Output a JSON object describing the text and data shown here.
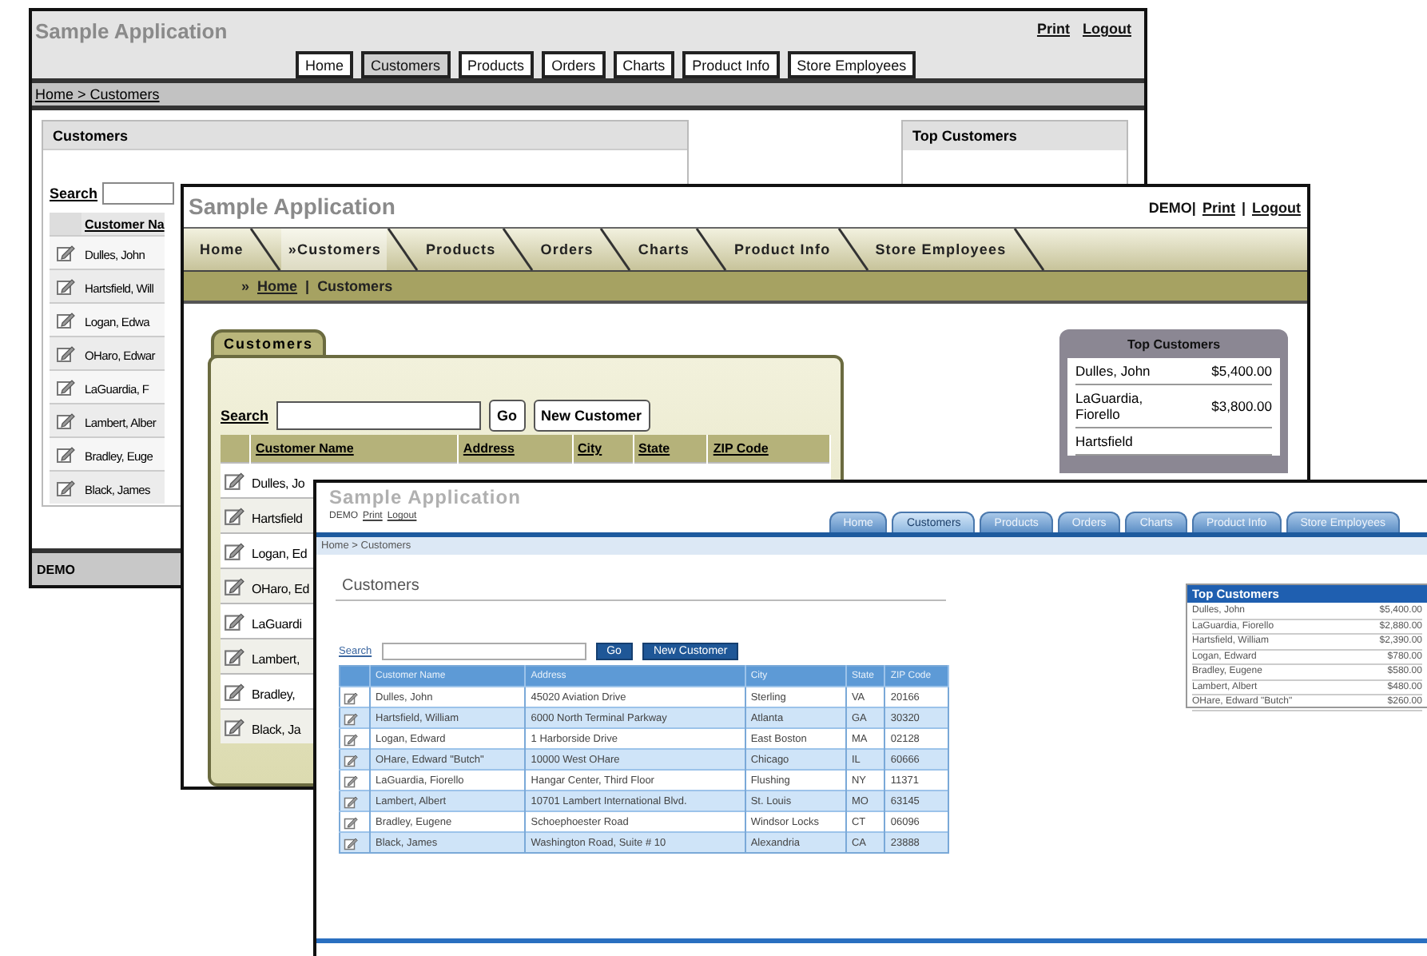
{
  "windows": [
    {
      "kind": "plain",
      "title": "Sample Application",
      "header_items": [
        {
          "text": "Print",
          "link": true
        },
        {
          "text": "Logout",
          "link": true
        }
      ],
      "tabs": [
        {
          "label": "Home",
          "selected": false
        },
        {
          "label": "Customers",
          "selected": true
        },
        {
          "label": "Products",
          "selected": false
        },
        {
          "label": "Orders",
          "selected": false
        },
        {
          "label": "Charts",
          "selected": false
        },
        {
          "label": "Product Info",
          "selected": false
        },
        {
          "label": "Store Employees",
          "selected": false
        }
      ],
      "breadcrumb": [
        {
          "text": "Home > Customers",
          "link": true
        }
      ],
      "region": {
        "title": "Customers",
        "search_label": "Search",
        "columns": [
          "Customer Na"
        ],
        "rows": [
          [
            "Dulles, John"
          ],
          [
            "Hartsfield, Will"
          ],
          [
            "Logan, Edwa"
          ],
          [
            "OHaro, Edwar"
          ],
          [
            "LaGuardia, F"
          ],
          [
            "Lambert, Alber"
          ],
          [
            "Bradley, Euge"
          ],
          [
            "Black, James"
          ]
        ]
      },
      "top_customers": {
        "title": "Top Customers"
      },
      "footer": "DEMO"
    },
    {
      "kind": "olive",
      "title": "Sample Application",
      "header_items": [
        {
          "text": "DEMO|",
          "link": false
        },
        {
          "text": "Print",
          "link": true
        },
        {
          "text": "|"
        },
        {
          "text": "Logout",
          "link": true
        }
      ],
      "tabs": [
        {
          "label": "Home",
          "selected": false
        },
        {
          "label": "»Customers",
          "selected": true
        },
        {
          "label": "Products",
          "selected": false
        },
        {
          "label": "Orders",
          "selected": false
        },
        {
          "label": "Charts",
          "selected": false
        },
        {
          "label": "Product Info",
          "selected": false
        },
        {
          "label": "Store Employees",
          "selected": false
        }
      ],
      "breadcrumb": [
        {
          "text": "»",
          "link": false
        },
        {
          "text": "Home",
          "link": true
        },
        {
          "text": "|"
        },
        {
          "text": "Customers",
          "link": false
        }
      ],
      "region": {
        "title": "Customers",
        "search_label": "Search",
        "buttons": [
          "Go",
          "New Customer"
        ],
        "columns": [
          "Customer Name",
          "Address",
          "City",
          "State",
          "ZIP Code"
        ],
        "rows": [
          [
            "Dulles, Jo"
          ],
          [
            "Hartsfield"
          ],
          [
            "Logan, Ed"
          ],
          [
            "OHaro, Ed"
          ],
          [
            "LaGuardi"
          ],
          [
            "Lambert,"
          ],
          [
            "Bradley,"
          ],
          [
            "Black, Ja"
          ]
        ]
      },
      "top_customers": {
        "title": "Top Customers",
        "rows": [
          [
            "Dulles, John",
            "$5,400.00"
          ],
          [
            "LaGuardia, Fiorello",
            "$3,800.00"
          ],
          [
            "Hartsfield"
          ]
        ]
      }
    },
    {
      "kind": "blue",
      "title": "Sample Application",
      "header_items": [
        {
          "text": "DEMO",
          "link": false
        },
        {
          "text": "Print",
          "link": true
        },
        {
          "text": "Logout",
          "link": true
        }
      ],
      "tabs": [
        {
          "label": "Home",
          "selected": false
        },
        {
          "label": "Customers",
          "selected": true
        },
        {
          "label": "Products",
          "selected": false
        },
        {
          "label": "Orders",
          "selected": false
        },
        {
          "label": "Charts",
          "selected": false
        },
        {
          "label": "Product Info",
          "selected": false
        },
        {
          "label": "Store Employees",
          "selected": false
        }
      ],
      "breadcrumb": [
        {
          "text": "Home > Customers",
          "link": false
        }
      ],
      "region": {
        "title": "Customers",
        "search_label": "Search",
        "buttons": [
          "Go",
          "New Customer"
        ],
        "columns": [
          "Customer Name",
          "Address",
          "City",
          "State",
          "ZIP Code"
        ],
        "rows": [
          [
            "Dulles, John",
            "45020 Aviation Drive",
            "Sterling",
            "VA",
            "20166"
          ],
          [
            "Hartsfield, William",
            "6000 North Terminal Parkway",
            "Atlanta",
            "GA",
            "30320"
          ],
          [
            "Logan, Edward",
            "1 Harborside Drive",
            "East Boston",
            "MA",
            "02128"
          ],
          [
            "OHare, Edward \"Butch\"",
            "10000 West OHare",
            "Chicago",
            "IL",
            "60666"
          ],
          [
            "LaGuardia, Fiorello",
            "Hangar Center, Third Floor",
            "Flushing",
            "NY",
            "11371"
          ],
          [
            "Lambert, Albert",
            "10701 Lambert International Blvd.",
            "St. Louis",
            "MO",
            "63145"
          ],
          [
            "Bradley, Eugene",
            "Schoephoester Road",
            "Windsor Locks",
            "CT",
            "06096"
          ],
          [
            "Black, James",
            "Washington Road, Suite # 10",
            "Alexandria",
            "CA",
            "23888"
          ]
        ]
      },
      "top_customers": {
        "title": "Top Customers",
        "rows": [
          [
            "Dulles, John",
            "$5,400.00"
          ],
          [
            "LaGuardia, Fiorello",
            "$2,880.00"
          ],
          [
            "Hartsfield, William",
            "$2,390.00"
          ],
          [
            "Logan, Edward",
            "$780.00"
          ],
          [
            "Bradley, Eugene",
            "$580.00"
          ],
          [
            "Lambert, Albert",
            "$480.00"
          ],
          [
            "OHare, Edward \"Butch\"",
            "$260.00"
          ]
        ]
      }
    }
  ]
}
